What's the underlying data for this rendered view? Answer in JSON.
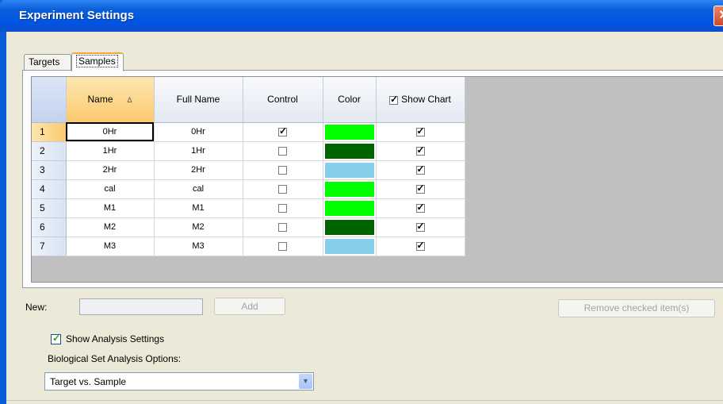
{
  "window": {
    "title": "Experiment Settings",
    "close_glyph": "✕"
  },
  "tabs": [
    {
      "label": "Targets",
      "active": false
    },
    {
      "label": "Samples",
      "active": true
    }
  ],
  "table": {
    "columns": {
      "name": "Name",
      "full_name": "Full Name",
      "control": "Control",
      "color": "Color",
      "show_chart": "Show Chart"
    },
    "sort_indicator": "Δ",
    "rows": [
      {
        "num": "1",
        "name": "0Hr",
        "full_name": "0Hr",
        "control": true,
        "color": "#00ff00",
        "show_chart": true
      },
      {
        "num": "2",
        "name": "1Hr",
        "full_name": "1Hr",
        "control": false,
        "color": "#006400",
        "show_chart": true
      },
      {
        "num": "3",
        "name": "2Hr",
        "full_name": "2Hr",
        "control": false,
        "color": "#87ceeb",
        "show_chart": true
      },
      {
        "num": "4",
        "name": "cal",
        "full_name": "cal",
        "control": false,
        "color": "#00ff00",
        "show_chart": true
      },
      {
        "num": "5",
        "name": "M1",
        "full_name": "M1",
        "control": false,
        "color": "#00ff00",
        "show_chart": true
      },
      {
        "num": "6",
        "name": "M2",
        "full_name": "M2",
        "control": false,
        "color": "#006400",
        "show_chart": true
      },
      {
        "num": "7",
        "name": "M3",
        "full_name": "M3",
        "control": false,
        "color": "#87ceeb",
        "show_chart": true
      }
    ]
  },
  "new_sample": {
    "label": "New:",
    "value": "",
    "add_label": "Add"
  },
  "remove_label": "Remove checked item(s)",
  "analysis": {
    "show_label": "Show Analysis Settings",
    "show_checked": true,
    "bio_label": "Biological Set Analysis Options:",
    "selected": "Target vs. Sample"
  }
}
